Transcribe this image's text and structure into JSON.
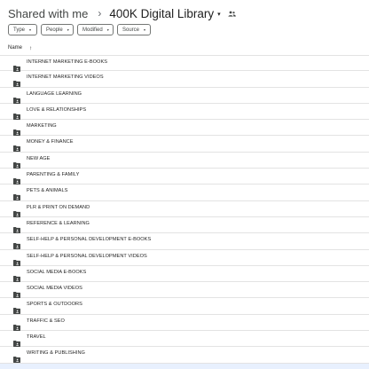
{
  "breadcrumb": {
    "root": "Shared with me",
    "separator": "›",
    "current": "400K Digital Library",
    "caret": "▾",
    "shared_icon": "people-icon"
  },
  "filters": [
    {
      "label": "Type",
      "caret": "▾"
    },
    {
      "label": "People",
      "caret": "▾"
    },
    {
      "label": "Modified",
      "caret": "▾"
    },
    {
      "label": "Source",
      "caret": "▾"
    }
  ],
  "list": {
    "column_name": "Name",
    "sort_icon": "arrow-up-icon",
    "sort_arrow": "↑",
    "folder_icon": "shared-folder-icon",
    "items": [
      {
        "label": "INTERNET MARKETING E-BOOKS"
      },
      {
        "label": "INTERNET MARKETING VIDEOS"
      },
      {
        "label": "LANGUAGE LEARNING"
      },
      {
        "label": "LOVE & RELATIONSHIPS"
      },
      {
        "label": "MARKETING"
      },
      {
        "label": "MONEY & FINANCE"
      },
      {
        "label": "NEW AGE"
      },
      {
        "label": "PARENTING & FAMILY"
      },
      {
        "label": "PETS & ANIMALS"
      },
      {
        "label": "PLR & PRINT ON DEMAND"
      },
      {
        "label": "REFERENCE & LEARNING"
      },
      {
        "label": "SELF-HELP & PERSONAL DEVELOPMENT E-BOOKS"
      },
      {
        "label": "SELF-HELP & PERSONAL DEVELOPMENT VIDEOS"
      },
      {
        "label": "SOCIAL MEDIA E-BOOKS"
      },
      {
        "label": "SOCIAL MEDIA VIDEOS"
      },
      {
        "label": "SPORTS & OUTDOORS"
      },
      {
        "label": "TRAFFIC & SEO"
      },
      {
        "label": "TRAVEL"
      },
      {
        "label": "WRITING & PUBLISHING"
      }
    ]
  },
  "colors": {
    "text": "#1f1f1f",
    "icon": "#444746",
    "divider": "#e3e3e3",
    "selection": "#e8f0fe"
  }
}
